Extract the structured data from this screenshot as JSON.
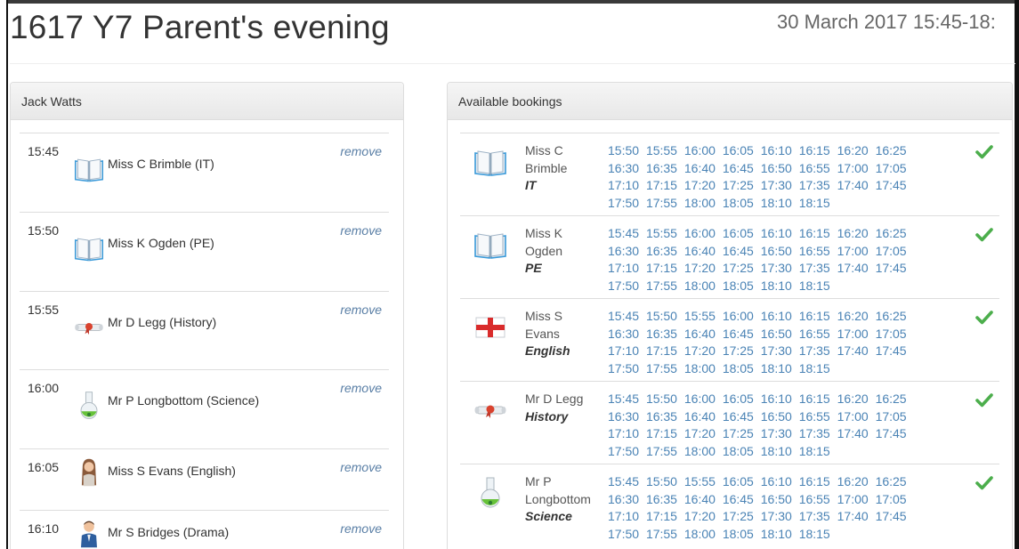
{
  "page": {
    "title": "1617 Y7 Parent's evening",
    "date": "30 March 2017 15:45-18:"
  },
  "student_panel": {
    "heading": "Jack Watts",
    "appointments": [
      {
        "time": "15:45",
        "teacher": "Miss C Brimble (IT)",
        "icon": "book-icon",
        "action": "remove"
      },
      {
        "time": "15:50",
        "teacher": "Miss K Ogden (PE)",
        "icon": "book-icon",
        "action": "remove"
      },
      {
        "time": "15:55",
        "teacher": "Mr D Legg (History)",
        "icon": "scroll-icon",
        "action": "remove"
      },
      {
        "time": "16:00",
        "teacher": "Mr P Longbottom (Science)",
        "icon": "flask-icon",
        "action": "remove"
      },
      {
        "time": "16:05",
        "teacher": "Miss S Evans (English)",
        "icon": "avatar-female-icon",
        "action": "remove"
      },
      {
        "time": "16:10",
        "teacher": "Mr S Bridges (Drama)",
        "icon": "avatar-male-icon",
        "action": "remove"
      }
    ]
  },
  "bookings_panel": {
    "heading": "Available bookings",
    "rows": [
      {
        "name_lines": [
          "Miss C",
          "Brimble"
        ],
        "subject": "IT",
        "icon": "book-icon",
        "slots": [
          "15:50",
          "15:55",
          "16:00",
          "16:05",
          "16:10",
          "16:15",
          "16:20",
          "16:25",
          "16:30",
          "16:35",
          "16:40",
          "16:45",
          "16:50",
          "16:55",
          "17:00",
          "17:05",
          "17:10",
          "17:15",
          "17:20",
          "17:25",
          "17:30",
          "17:35",
          "17:40",
          "17:45",
          "17:50",
          "17:55",
          "18:00",
          "18:05",
          "18:10",
          "18:15"
        ]
      },
      {
        "name_lines": [
          "Miss K",
          "Ogden"
        ],
        "subject": "PE",
        "icon": "book-icon",
        "slots": [
          "15:45",
          "15:55",
          "16:00",
          "16:05",
          "16:10",
          "16:15",
          "16:20",
          "16:25",
          "16:30",
          "16:35",
          "16:40",
          "16:45",
          "16:50",
          "16:55",
          "17:00",
          "17:05",
          "17:10",
          "17:15",
          "17:20",
          "17:25",
          "17:30",
          "17:35",
          "17:40",
          "17:45",
          "17:50",
          "17:55",
          "18:00",
          "18:05",
          "18:10",
          "18:15"
        ]
      },
      {
        "name_lines": [
          "Miss S",
          "Evans"
        ],
        "subject": "English",
        "icon": "england-flag-icon",
        "slots": [
          "15:45",
          "15:50",
          "15:55",
          "16:00",
          "16:10",
          "16:15",
          "16:20",
          "16:25",
          "16:30",
          "16:35",
          "16:40",
          "16:45",
          "16:50",
          "16:55",
          "17:00",
          "17:05",
          "17:10",
          "17:15",
          "17:20",
          "17:25",
          "17:30",
          "17:35",
          "17:40",
          "17:45",
          "17:50",
          "17:55",
          "18:00",
          "18:05",
          "18:10",
          "18:15"
        ]
      },
      {
        "name_lines": [
          "Mr D Legg"
        ],
        "subject": "History",
        "icon": "scroll-icon",
        "slots": [
          "15:45",
          "15:50",
          "16:00",
          "16:05",
          "16:10",
          "16:15",
          "16:20",
          "16:25",
          "16:30",
          "16:35",
          "16:40",
          "16:45",
          "16:50",
          "16:55",
          "17:00",
          "17:05",
          "17:10",
          "17:15",
          "17:20",
          "17:25",
          "17:30",
          "17:35",
          "17:40",
          "17:45",
          "17:50",
          "17:55",
          "18:00",
          "18:05",
          "18:10",
          "18:15"
        ]
      },
      {
        "name_lines": [
          "Mr P",
          "Longbottom"
        ],
        "subject": "Science",
        "icon": "flask-icon",
        "slots": [
          "15:45",
          "15:50",
          "15:55",
          "16:05",
          "16:10",
          "16:15",
          "16:20",
          "16:25",
          "16:30",
          "16:35",
          "16:40",
          "16:45",
          "16:50",
          "16:55",
          "17:00",
          "17:05",
          "17:10",
          "17:15",
          "17:20",
          "17:25",
          "17:30",
          "17:35",
          "17:40",
          "17:45",
          "17:50",
          "17:55",
          "18:00",
          "18:05",
          "18:10",
          "18:15"
        ]
      }
    ]
  },
  "colors": {
    "link": "#4a83b5",
    "remove": "#5a7fa6",
    "check": "#4cae4c"
  }
}
